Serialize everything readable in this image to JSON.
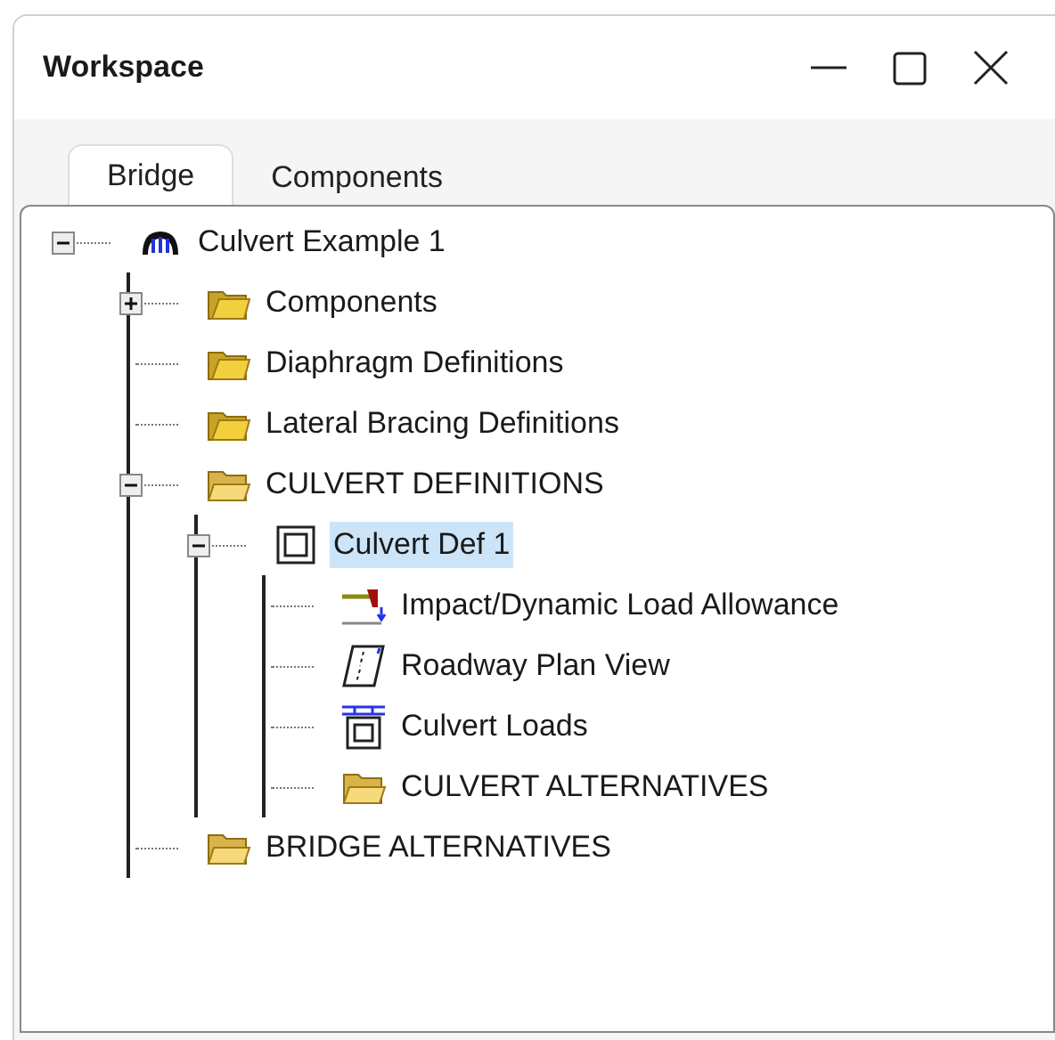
{
  "window": {
    "title": "Workspace"
  },
  "tabs": [
    {
      "label": "Bridge",
      "selected": true
    },
    {
      "label": "Components",
      "selected": false
    }
  ],
  "tree": [
    {
      "label": "Culvert Example 1",
      "kind": "bridge",
      "expanded": true,
      "selected": false,
      "children": [
        {
          "label": "Components",
          "kind": "folder",
          "expanded": false,
          "selected": false
        },
        {
          "label": "Diaphragm Definitions",
          "kind": "folder",
          "selected": false
        },
        {
          "label": "Lateral Bracing Definitions",
          "kind": "folder",
          "selected": false
        },
        {
          "label": "CULVERT DEFINITIONS",
          "kind": "open-folder",
          "expanded": true,
          "selected": false,
          "children": [
            {
              "label": "Culvert Def 1",
              "kind": "culvert",
              "expanded": true,
              "selected": true,
              "children": [
                {
                  "label": "Impact/Dynamic Load Allowance",
                  "kind": "impact",
                  "selected": false
                },
                {
                  "label": "Roadway Plan View",
                  "kind": "roadway",
                  "selected": false
                },
                {
                  "label": "Culvert Loads",
                  "kind": "loads",
                  "selected": false
                },
                {
                  "label": "CULVERT ALTERNATIVES",
                  "kind": "open-folder",
                  "selected": false
                }
              ]
            }
          ]
        },
        {
          "label": "BRIDGE ALTERNATIVES",
          "kind": "open-folder",
          "selected": false
        }
      ]
    }
  ]
}
